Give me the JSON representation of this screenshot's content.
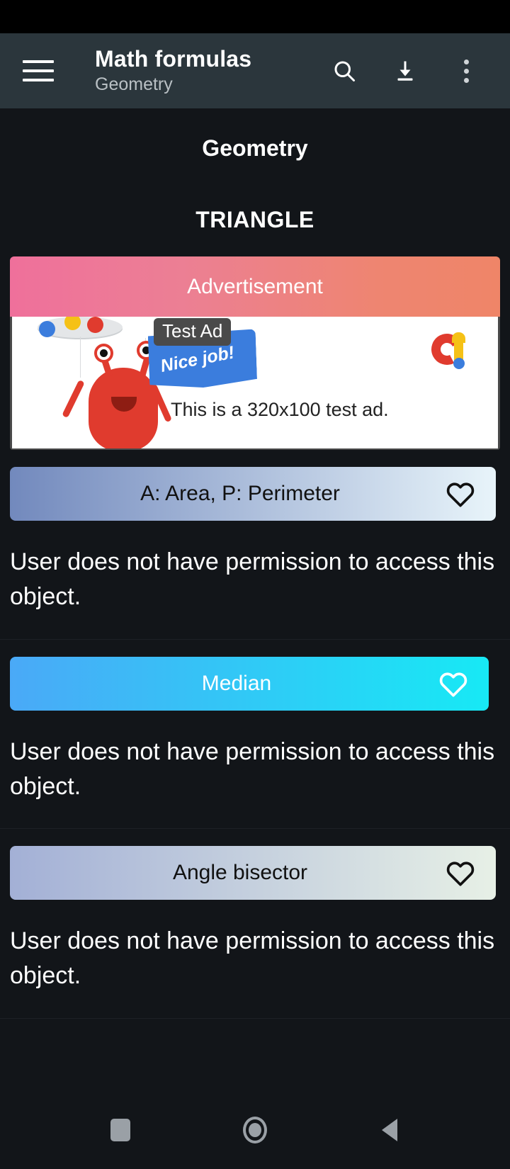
{
  "app_bar": {
    "menu_icon": "hamburger-menu-icon",
    "title": "Math formulas",
    "subtitle": "Geometry",
    "search_icon": "search-icon",
    "download_icon": "download-icon",
    "overflow_icon": "more-vertical-icon"
  },
  "page": {
    "heading": "Geometry",
    "section": "TRIANGLE"
  },
  "advertisement": {
    "label": "Advertisement",
    "badge": "Test Ad",
    "ribbon_text": "Nice job!",
    "body_text": "This is a 320x100 test ad.",
    "network_logo": "admob-logo-icon",
    "label_gradient_start": "#ef709b",
    "label_gradient_end": "#ef8568"
  },
  "cards": [
    {
      "title": "A: Area, P: Perimeter",
      "body": "User does not have permission to access this object.",
      "title_color": "#111111",
      "heart_color": "#111111",
      "gradient_start": "#7289bd",
      "gradient_end": "#e8f4fa",
      "heart_icon": "heart-outline-icon",
      "width_mode": "inset"
    },
    {
      "title": "Median",
      "body": "User does not have permission to access this object.",
      "title_color": "#ffffff",
      "heart_color": "#ffffff",
      "gradient_start": "#4aa9f7",
      "gradient_end": "#17e9f5",
      "heart_icon": "heart-outline-icon",
      "width_mode": "wide"
    },
    {
      "title": "Angle bisector",
      "body": "User does not have permission to access this object.",
      "title_color": "#111111",
      "heart_color": "#111111",
      "gradient_start": "#a3b0d6",
      "gradient_end": "#e7f0e6",
      "heart_icon": "heart-outline-icon",
      "width_mode": "inset"
    }
  ],
  "nav_bar": {
    "recents": "recents-square-icon",
    "home": "home-circle-icon",
    "back": "back-triangle-icon"
  }
}
